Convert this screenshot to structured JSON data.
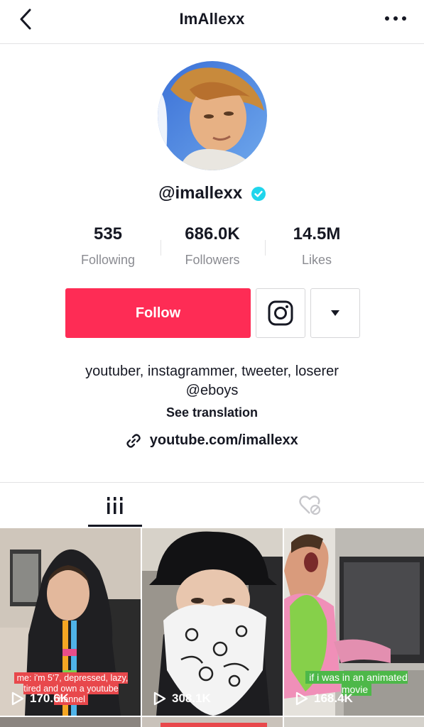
{
  "header": {
    "title": "ImAllexx"
  },
  "profile": {
    "handle": "@imallexx",
    "stats": [
      {
        "value": "535",
        "label": "Following"
      },
      {
        "value": "686.0K",
        "label": "Followers"
      },
      {
        "value": "14.5M",
        "label": "Likes"
      }
    ],
    "follow_label": "Follow",
    "bio_line1": "youtuber, instagrammer, tweeter, loserer",
    "bio_line2": "@eboys",
    "see_translation": "See translation",
    "link": "youtube.com/imallexx"
  },
  "videos": [
    {
      "views": "170.6K",
      "caption": "me: i'm 5'7, depressed, lazy, tired and own a youtube channel"
    },
    {
      "views": "308.1K",
      "caption": ""
    },
    {
      "views": "168.4K",
      "caption": "if i was in an animated movie"
    }
  ],
  "colors": {
    "accent": "#fe2c55",
    "verified": "#20d5ec",
    "text": "#161823",
    "muted": "#8a8b91"
  }
}
